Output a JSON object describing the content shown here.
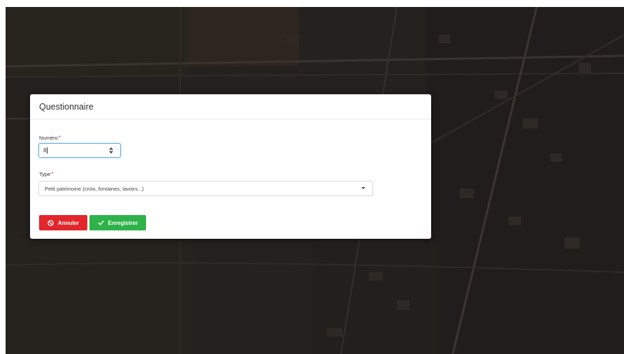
{
  "modal": {
    "title": "Questionnaire",
    "numero": {
      "label": "Numéro",
      "required_marker": "*",
      "value": "8"
    },
    "type": {
      "label": "Type",
      "required_marker": "*",
      "selected": "Petit patrimoine (croix, fontaines, lavoirs...)"
    },
    "buttons": {
      "cancel_label": "Annuler",
      "save_label": "Enregistrer"
    }
  },
  "colors": {
    "cancel": "#e3262b",
    "save": "#2eb34a",
    "required": "#e53935",
    "focus": "#66afe9"
  },
  "icons": {
    "cancel": "ban-icon",
    "save": "check-icon",
    "spinner": "spinner-arrows-icon",
    "dropdown": "caret-down-icon"
  }
}
